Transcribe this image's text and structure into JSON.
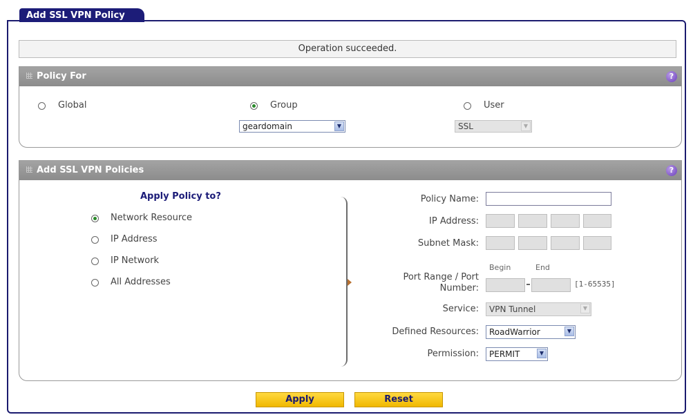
{
  "tab": {
    "title": "Add SSL VPN Policy"
  },
  "status_message": "Operation succeeded.",
  "policy_for": {
    "heading": "Policy For",
    "global_label": "Global",
    "group_label": "Group",
    "user_label": "User",
    "selected": "Group",
    "group_select": "geardomain",
    "user_select": "SSL"
  },
  "add_policies": {
    "heading": "Add SSL VPN Policies",
    "apply_heading": "Apply Policy to?",
    "options": [
      "Network Resource",
      "IP Address",
      "IP Network",
      "All Addresses"
    ],
    "selected_option": "Network Resource",
    "policy_name_label": "Policy Name:",
    "policy_name_value": "",
    "ip_address_label": "IP Address:",
    "subnet_mask_label": "Subnet Mask:",
    "begin_label": "Begin",
    "end_label": "End",
    "port_range_label_1": "Port Range / Port",
    "port_range_label_2": "Number:",
    "port_range_hint": "[1-65535]",
    "service_label": "Service:",
    "service_value": "VPN Tunnel",
    "defined_resources_label": "Defined Resources:",
    "defined_resources_value": "RoadWarrior",
    "permission_label": "Permission:",
    "permission_value": "PERMIT"
  },
  "buttons": {
    "apply": "Apply",
    "reset": "Reset"
  },
  "colors": {
    "tab": "#1c1c78",
    "section_header": "#9a9a9a",
    "button": "#f5c518",
    "help": "#7a4cc8"
  }
}
